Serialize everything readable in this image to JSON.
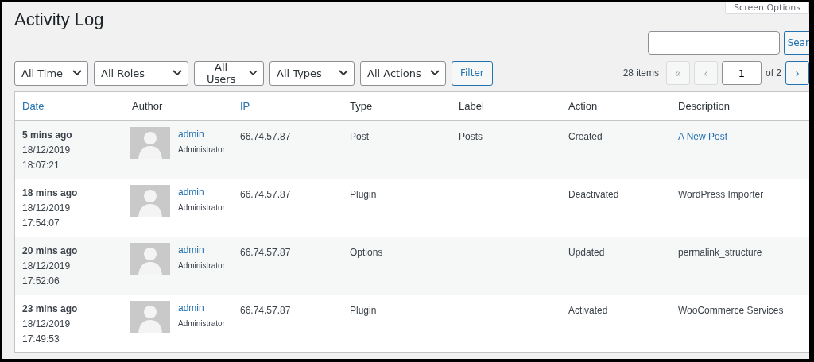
{
  "screen_options": {
    "label": "Screen Options"
  },
  "title": "Activity Log",
  "search": {
    "button": "Sear"
  },
  "filters": [
    {
      "label": "All Time"
    },
    {
      "label": "All Roles"
    },
    {
      "label": "All Users"
    },
    {
      "label": "All Types"
    },
    {
      "label": "All Actions"
    }
  ],
  "filter_button": "Filter",
  "pagination": {
    "count": "28 items",
    "first": {
      "label": "«",
      "disabled": true
    },
    "prev": {
      "label": "‹",
      "disabled": true
    },
    "page": "1",
    "of": "of 2",
    "next": {
      "label": "›",
      "disabled": false
    }
  },
  "table": {
    "columns": [
      {
        "label": "Date",
        "sortable": true
      },
      {
        "label": "Author",
        "sortable": false
      },
      {
        "label": "IP",
        "sortable": true
      },
      {
        "label": "Type",
        "sortable": false
      },
      {
        "label": "Label",
        "sortable": false
      },
      {
        "label": "Action",
        "sortable": false
      },
      {
        "label": "Description",
        "sortable": false
      }
    ],
    "rows": [
      {
        "ago": "5 mins ago",
        "date": "18/12/2019",
        "time": "18:07:21",
        "author": "admin",
        "role": "Administrator",
        "ip": "66.74.57.87",
        "type": "Post",
        "label": "Posts",
        "action": "Created",
        "description": "A New Post",
        "description_link": true
      },
      {
        "ago": "18 mins ago",
        "date": "18/12/2019",
        "time": "17:54:07",
        "author": "admin",
        "role": "Administrator",
        "ip": "66.74.57.87",
        "type": "Plugin",
        "action": "Deactivated",
        "description": "WordPress Importer",
        "description_link": false
      },
      {
        "ago": "20 mins ago",
        "date": "18/12/2019",
        "time": "17:52:06",
        "author": "admin",
        "role": "Administrator",
        "ip": "66.74.57.87",
        "type": "Options",
        "action": "Updated",
        "description": "permalink_structure",
        "description_link": false
      },
      {
        "ago": "23 mins ago",
        "date": "18/12/2019",
        "time": "17:49:53",
        "author": "admin",
        "role": "Administrator",
        "ip": "66.74.57.87",
        "type": "Plugin",
        "action": "Activated",
        "description": "WooCommerce Services",
        "description_link": false
      }
    ]
  }
}
